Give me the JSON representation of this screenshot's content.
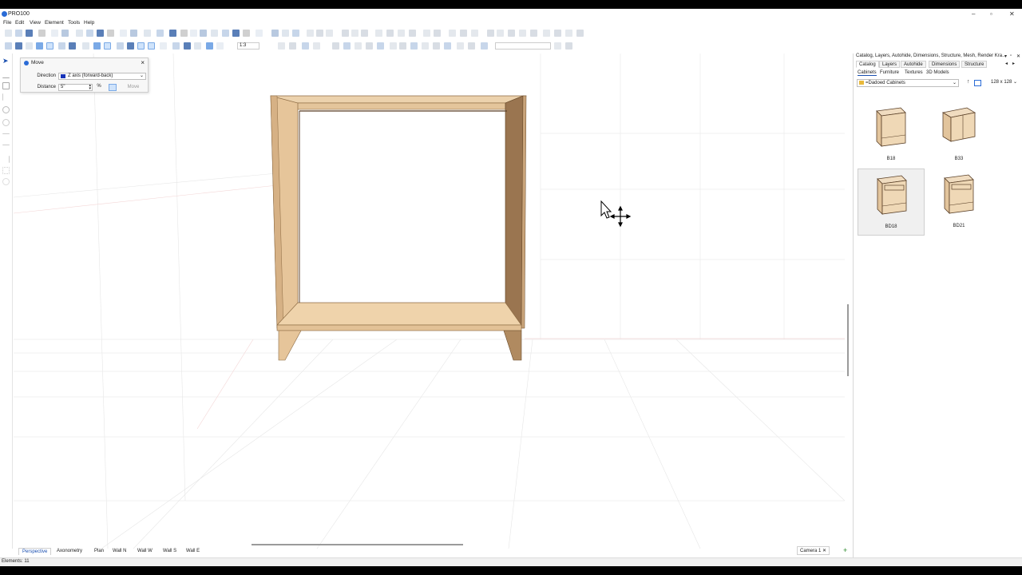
{
  "window": {
    "title": "PRO100",
    "controls": {
      "minimize": "–",
      "maximize": "▫",
      "close": "✕"
    }
  },
  "menu": [
    "File",
    "Edit",
    "View",
    "Element",
    "Tools",
    "Help"
  ],
  "toolbar": {
    "zoom_value": "1:3"
  },
  "move_dialog": {
    "title": "Move",
    "close": "×",
    "direction_label": "Direction",
    "direction_value": "Z axis (forward-back)",
    "direction_color": "#1733b8",
    "distance_label": "Distance",
    "distance_value": "5\"",
    "percent_symbol": "%",
    "move_button": "Move"
  },
  "view_tabs": [
    "Perspective",
    "Axonometry",
    "Plan",
    "Wall N",
    "Wall W",
    "Wall S",
    "Wall E"
  ],
  "active_view_tab": "Perspective",
  "camera_tab": {
    "label": "Camera 1",
    "close": "✕",
    "add": "+"
  },
  "status": {
    "text": "Elements: 11"
  },
  "right_panel": {
    "title": "Catalog, Layers, Autohide, Dimensions, Structure, Mesh, Render Kra...",
    "controls": {
      "pin": "▾",
      "restore": "▫",
      "close": "✕"
    },
    "tabs": [
      "Catalog",
      "Layers",
      "Autohide",
      "Dimensions",
      "Structure"
    ],
    "tab_nav": {
      "prev": "◂",
      "next": "▸"
    },
    "active_tab": "Catalog",
    "sub_tabs": [
      "Cabinets",
      "Furniture",
      "Textures",
      "3D Models"
    ],
    "active_sub_tab": "Cabinets",
    "category": "=Dadoed Cabinets",
    "up_arrow": "↑",
    "thumb_size": "128 x 128",
    "items": [
      {
        "label": "B18",
        "selected": false
      },
      {
        "label": "B33",
        "selected": false
      },
      {
        "label": "BD18",
        "selected": true
      },
      {
        "label": "BD21",
        "selected": false
      }
    ]
  },
  "colors": {
    "accent": "#2a6bd6",
    "cabinet_wood": "#e8c9a0",
    "cabinet_shadow": "#b58d5e"
  }
}
